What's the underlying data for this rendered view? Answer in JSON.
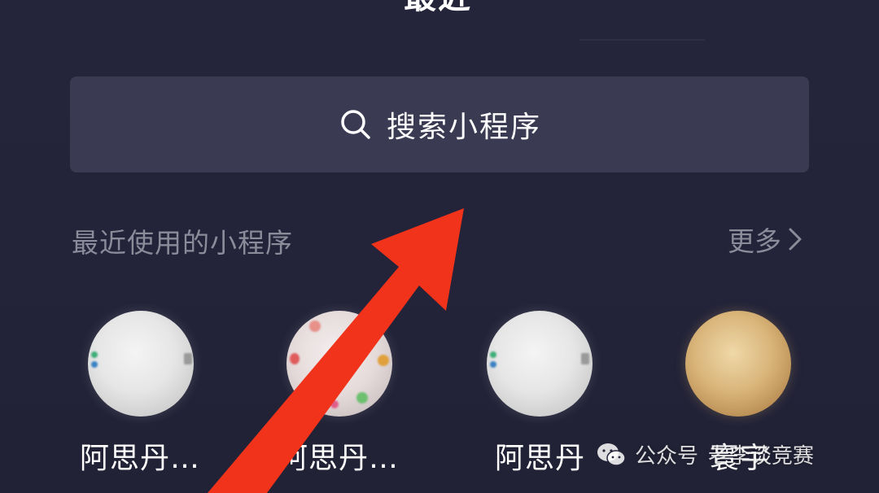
{
  "header": {
    "title": "最近"
  },
  "search": {
    "placeholder": "搜索小程序",
    "icon": "search-icon"
  },
  "section": {
    "title": "最近使用的小程序",
    "more_label": "更多",
    "more_icon": "chevron-right-icon"
  },
  "mini_programs": [
    {
      "label": "阿思丹…",
      "icon": "app-avatar-silver"
    },
    {
      "label": "阿思丹…",
      "icon": "app-avatar-colorful"
    },
    {
      "label": "阿思丹",
      "icon": "app-avatar-silver"
    },
    {
      "label": "寰宇",
      "icon": "app-avatar-gold"
    }
  ],
  "watermark": {
    "prefix": "公众号",
    "author": "老李谈竞赛",
    "icon": "wechat-icon"
  },
  "annotation": {
    "type": "arrow",
    "color": "#f2331b"
  },
  "colors": {
    "background": "#23233a",
    "search_bg": "#3a3a52",
    "muted_text": "#8b8b9a",
    "accent_arrow": "#f2331b"
  }
}
